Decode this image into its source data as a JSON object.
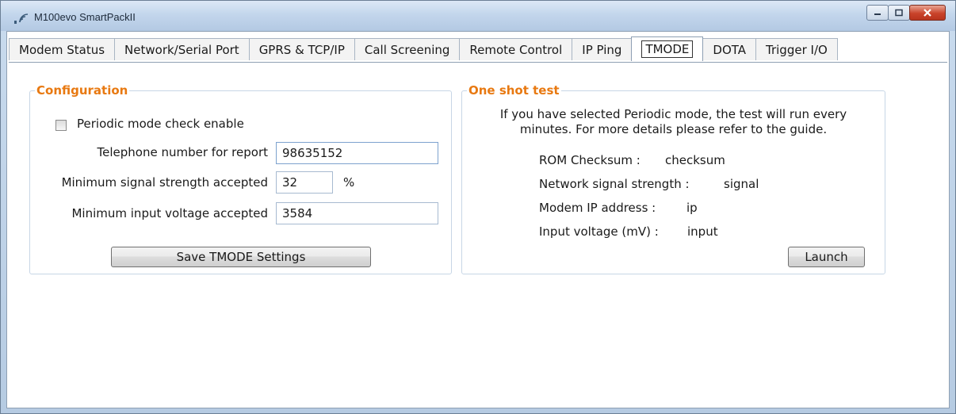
{
  "window": {
    "title": "M100evo SmartPackII"
  },
  "tabs": [
    {
      "label": "Modem Status"
    },
    {
      "label": "Network/Serial Port"
    },
    {
      "label": "GPRS & TCP/IP"
    },
    {
      "label": "Call Screening"
    },
    {
      "label": "Remote Control"
    },
    {
      "label": "IP Ping"
    },
    {
      "label": "TMODE",
      "active": true
    },
    {
      "label": "DOTA"
    },
    {
      "label": "Trigger I/O"
    }
  ],
  "configuration": {
    "legend": "Configuration",
    "periodic_label": "Periodic mode check enable",
    "periodic_checked": false,
    "phone_label": "Telephone number for report",
    "phone_value": "98635152",
    "signal_label": "Minimum signal strength accepted",
    "signal_value": "32",
    "signal_unit": "%",
    "voltage_label": "Minimum input voltage accepted",
    "voltage_value": "3584",
    "save_label": "Save TMODE Settings"
  },
  "oneshot": {
    "legend": "One shot test",
    "info_line1": "If you have selected Periodic mode, the test will run every",
    "info_line2": "minutes. For more details please refer to the guide.",
    "rom_label": "ROM Checksum :",
    "rom_value": "checksum",
    "signal_label": "Network signal strength :",
    "signal_value": "signal",
    "ip_label": "Modem IP address :",
    "ip_value": "ip",
    "voltage_label": "Input voltage (mV) :",
    "voltage_value": "input",
    "launch_label": "Launch"
  },
  "icons": {
    "app": "signal-wave-icon",
    "minimize": "minimize-icon",
    "maximize": "maximize-icon",
    "close": "close-icon"
  },
  "colors": {
    "legend": "#e87911",
    "close_button": "#c9432a"
  }
}
